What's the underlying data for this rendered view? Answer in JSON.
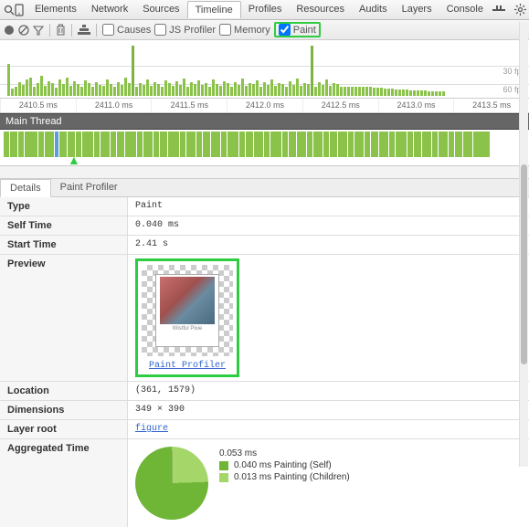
{
  "tabs": [
    "Elements",
    "Network",
    "Sources",
    "Timeline",
    "Profiles",
    "Resources",
    "Audits",
    "Layers",
    "Console"
  ],
  "activeTab": "Timeline",
  "toolbar": {
    "causes": "Causes",
    "jsprofiler": "JS Profiler",
    "memory": "Memory",
    "paint": "Paint"
  },
  "fps": {
    "l1": "30 fps",
    "l2": "60 fps"
  },
  "ruler": [
    "2410.5 ms",
    "2411.0 ms",
    "2411.5 ms",
    "2412.0 ms",
    "2412.5 ms",
    "2413.0 ms",
    "2413.5 ms"
  ],
  "mainthread": "Main Thread",
  "subtabs": {
    "details": "Details",
    "profiler": "Paint Profiler"
  },
  "details": {
    "type_k": "Type",
    "type_v": "Paint",
    "self_k": "Self Time",
    "self_v": "0.040 ms",
    "start_k": "Start Time",
    "start_v": "2.41 s",
    "prev_k": "Preview",
    "prev_cap": "Wistful Pixie",
    "prev_link": "Paint Profiler",
    "loc_k": "Location",
    "loc_v": "(361, 1579)",
    "dim_k": "Dimensions",
    "dim_v": "349 × 390",
    "layer_k": "Layer root",
    "layer_v": "figure",
    "agg_k": "Aggregated Time",
    "agg_total": "0.053 ms",
    "agg_self": "0.040 ms Painting (Self)",
    "agg_child": "0.013 ms Painting (Children)"
  },
  "chart_data": {
    "type": "pie",
    "title": "Aggregated Time",
    "values": [
      0.04,
      0.013
    ],
    "categories": [
      "Painting (Self)",
      "Painting (Children)"
    ],
    "total": 0.053,
    "unit": "ms",
    "colors": [
      "#6fb536",
      "#a5d66a"
    ]
  }
}
